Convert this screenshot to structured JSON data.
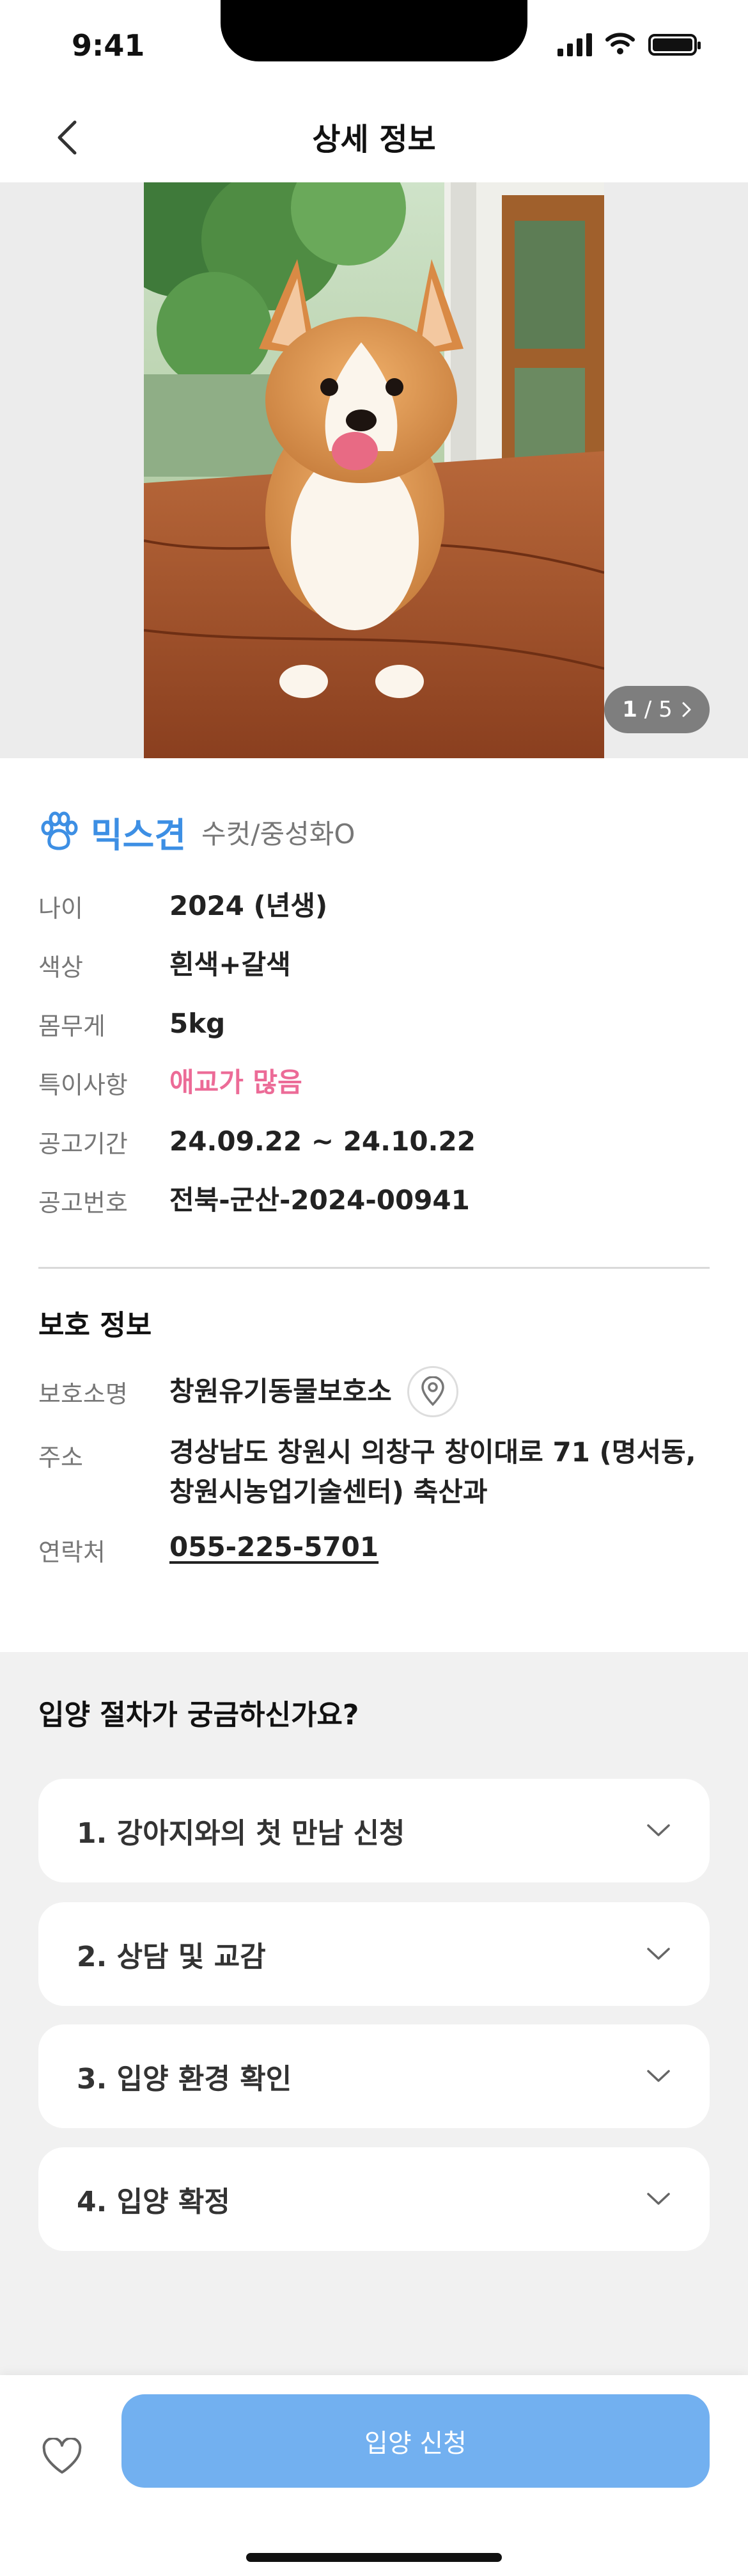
{
  "status_bar": {
    "time": "9:41"
  },
  "header": {
    "title": "상세 정보"
  },
  "gallery": {
    "current": "1",
    "separator": "/",
    "total": "5"
  },
  "pet": {
    "breed": "믹스견",
    "sub": "수컷/중성화O",
    "rows": [
      {
        "label": "나이",
        "value": "2024 (년생)"
      },
      {
        "label": "색상",
        "value": "흰색+갈색"
      },
      {
        "label": "몸무게",
        "value": "5kg"
      },
      {
        "label": "특이사항",
        "value": "애교가 많음"
      },
      {
        "label": "공고기간",
        "value": "24.09.22 ~ 24.10.22"
      },
      {
        "label": "공고번호",
        "value": "전북-군산-2024-00941"
      }
    ]
  },
  "shelter": {
    "title": "보호 정보",
    "name_label": "보호소명",
    "name": "창원유기동물보호소",
    "address_label": "주소",
    "address_line1": "경상남도 창원시 의창구 창이대로 71 (명서동,",
    "address_line2": "창원시농업기술센터) 축산과",
    "phone_label": "연락처",
    "phone": "055-225-5701"
  },
  "procedure": {
    "title": "입양 절차가 궁금하신가요?",
    "steps": [
      {
        "label": "1. 강아지와의 첫 만남 신청"
      },
      {
        "label": "2. 상담 및 교감"
      },
      {
        "label": "3. 입양 환경 확인"
      },
      {
        "label": "4. 입양 확정"
      }
    ]
  },
  "bottom": {
    "apply_label": "입양 신청"
  },
  "colors": {
    "accent": "#3d8fe4",
    "highlight": "#ec6b97",
    "button": "#72b0f0"
  }
}
